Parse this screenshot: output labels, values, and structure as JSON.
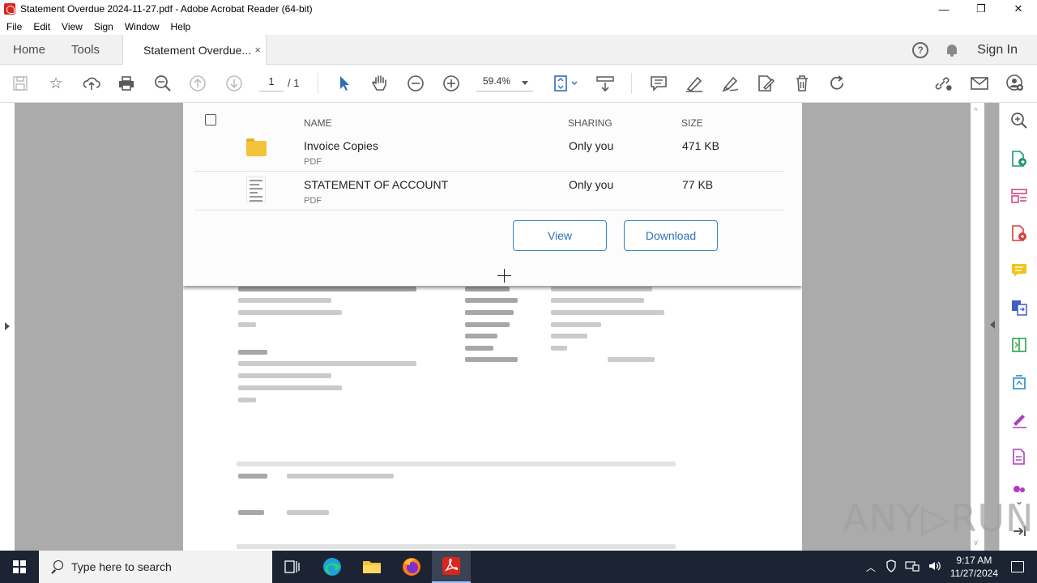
{
  "window": {
    "title": "Statement Overdue 2024-11-27.pdf - Adobe Acrobat Reader (64-bit)",
    "minimize": "—",
    "maximize": "❐",
    "close": "✕"
  },
  "menu": [
    "File",
    "Edit",
    "View",
    "Sign",
    "Window",
    "Help"
  ],
  "tabs": {
    "home": "Home",
    "tools": "Tools",
    "doc": "Statement Overdue...",
    "close": "×"
  },
  "header_right": {
    "help": "?",
    "sign_in": "Sign In"
  },
  "toolbar": {
    "page_current": "1",
    "page_total": "/ 1",
    "zoom": "59.4%"
  },
  "popup": {
    "headers": {
      "name": "NAME",
      "sharing": "SHARING",
      "size": "SIZE"
    },
    "files": [
      {
        "name": "Invoice Copies",
        "type": "PDF",
        "sharing": "Only you",
        "size": "471 KB",
        "icon": "folder-icon"
      },
      {
        "name": "STATEMENT OF ACCOUNT",
        "type": "PDF",
        "sharing": "Only you",
        "size": "77 KB",
        "icon": "document-thumbnail"
      }
    ],
    "view_label": "View",
    "download_label": "Download"
  },
  "watermark": "ANY▷RUN",
  "taskbar": {
    "search_placeholder": "Type here to search",
    "time": "9:17 AM",
    "date": "11/27/2024"
  },
  "colors": {
    "accent": "#2d6fb5",
    "acrobat_red": "#d9261c",
    "taskbar": "#1c2433"
  }
}
